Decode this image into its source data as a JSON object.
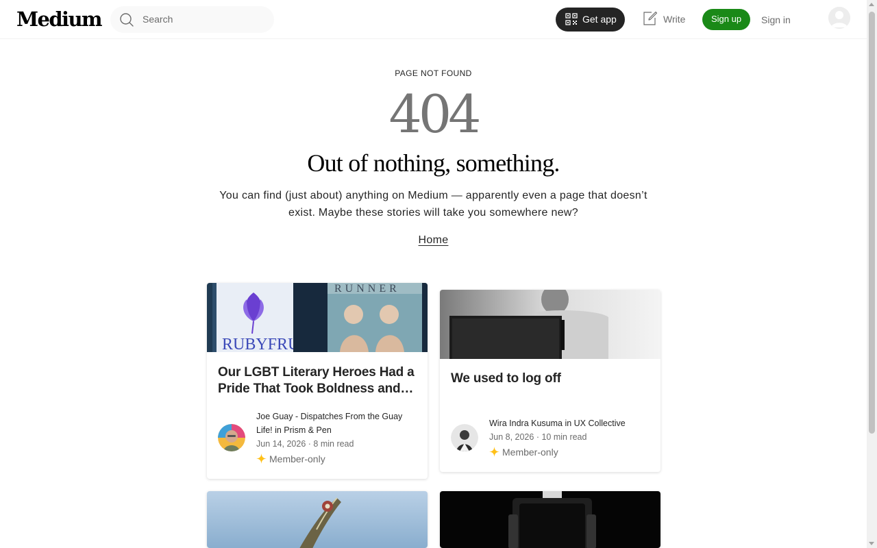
{
  "header": {
    "logo": "Medium",
    "search_placeholder": "Search",
    "get_app_label": "Get app",
    "write_label": "Write",
    "sign_up_label": "Sign up",
    "sign_in_label": "Sign in"
  },
  "hero": {
    "eyebrow": "PAGE NOT FOUND",
    "code": "404",
    "headline": "Out of nothing, something.",
    "description": "You can find (just about) anything on Medium — apparently even a page that doesn’t exist. Maybe these stories will take you somewhere new?",
    "home_link": "Home"
  },
  "cards": [
    {
      "title": "Our LGBT Literary Heroes Had a Pride That Took Boldness and…",
      "author": "Joe Guay - Dispatches From the Guay Life! in Prism & Pen",
      "date": "Jun 14, 2026",
      "read_time": "8 min read",
      "badge": "Member-only",
      "image_text_left": "RUBYFRUIT",
      "image_text_right": "RUNNER"
    },
    {
      "title": "We used to log off",
      "author": "Wira Indra Kusuma in UX Collective",
      "date": "Jun 8, 2026",
      "read_time": "10 min read",
      "badge": "Member-only"
    }
  ],
  "colors": {
    "brand_green": "#1a8917",
    "dark_button": "#242424",
    "muted_text": "#6b6b6b",
    "star": "#ffc017"
  }
}
